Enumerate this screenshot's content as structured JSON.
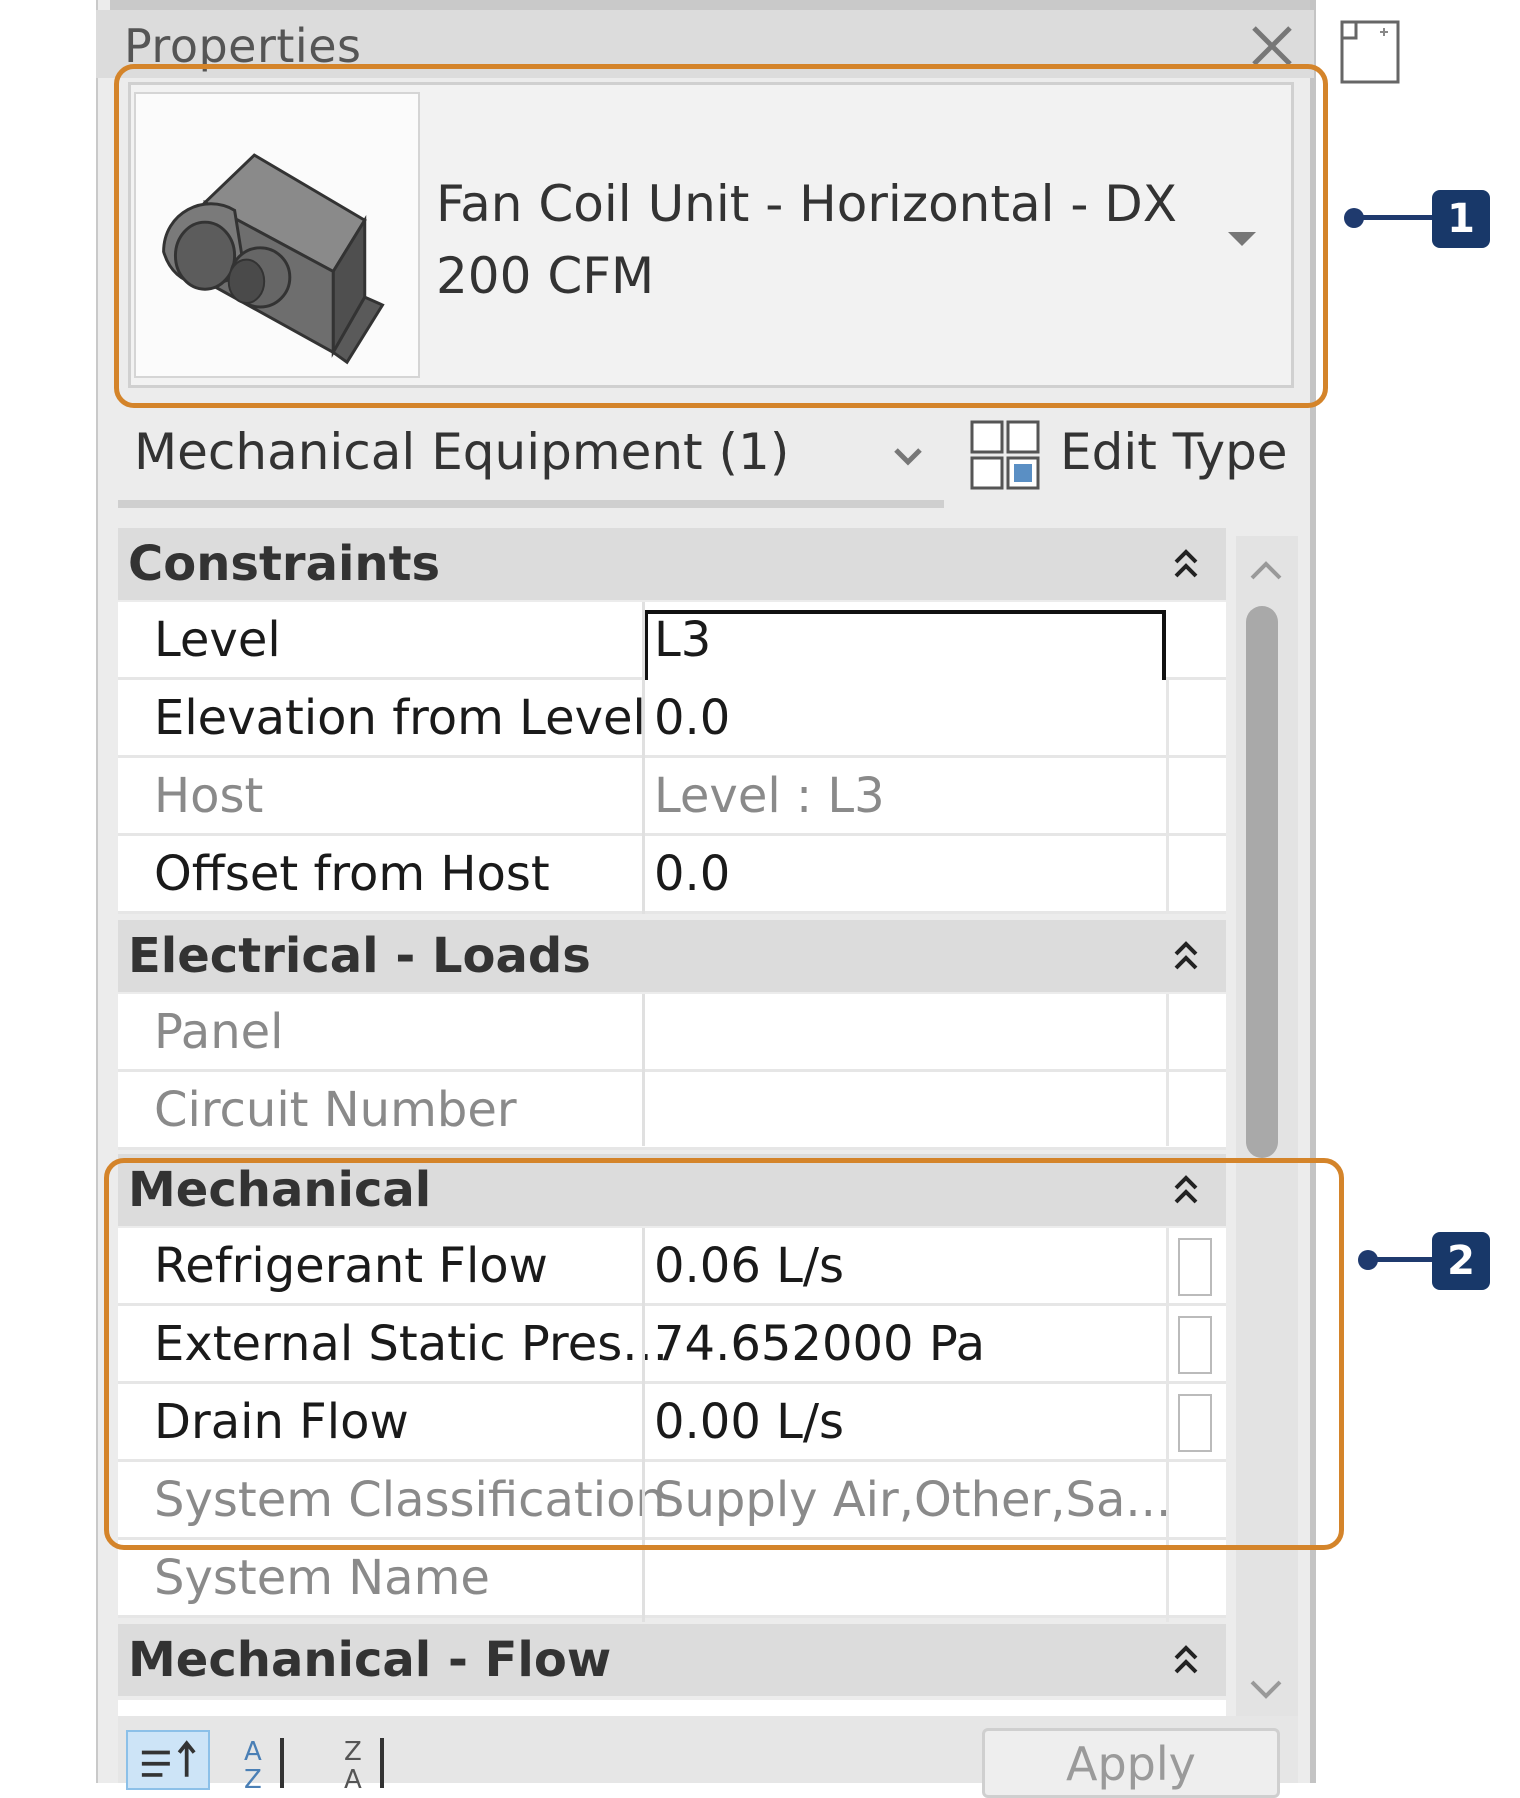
{
  "panel": {
    "title": "Properties"
  },
  "type_selector": {
    "name_line1": "Fan Coil Unit - Horizontal - DX",
    "name_line2": "200 CFM"
  },
  "filter": {
    "label": "Mechanical Equipment (1)"
  },
  "edit_type": {
    "label": "Edit Type"
  },
  "groups": {
    "constraints": {
      "label": "Constraints",
      "rows": [
        {
          "name": "Level",
          "value": "L3"
        },
        {
          "name": "Elevation from Level",
          "value": "0.0"
        },
        {
          "name": "Host",
          "value": "Level : L3"
        },
        {
          "name": "Offset from Host",
          "value": "0.0"
        }
      ]
    },
    "electrical_loads": {
      "label": "Electrical - Loads",
      "rows": [
        {
          "name": "Panel",
          "value": ""
        },
        {
          "name": "Circuit Number",
          "value": ""
        }
      ]
    },
    "mechanical": {
      "label": "Mechanical",
      "rows": [
        {
          "name": "Refrigerant Flow",
          "value": "0.06 L/s"
        },
        {
          "name": "External Static Pres...",
          "value": "74.652000 Pa"
        },
        {
          "name": "Drain Flow",
          "value": "0.00 L/s"
        },
        {
          "name": "System Classification",
          "value": "Supply Air,Other,Sa..."
        },
        {
          "name": "System Name",
          "value": ""
        }
      ]
    },
    "mechanical_flow": {
      "label": "Mechanical - Flow"
    }
  },
  "footer": {
    "apply_label": "Apply"
  },
  "annotations": {
    "badge1": "1",
    "badge2": "2"
  },
  "colors": {
    "callout": "#d4842a",
    "badge": "#183869",
    "sort_active": "#cde4f7"
  }
}
